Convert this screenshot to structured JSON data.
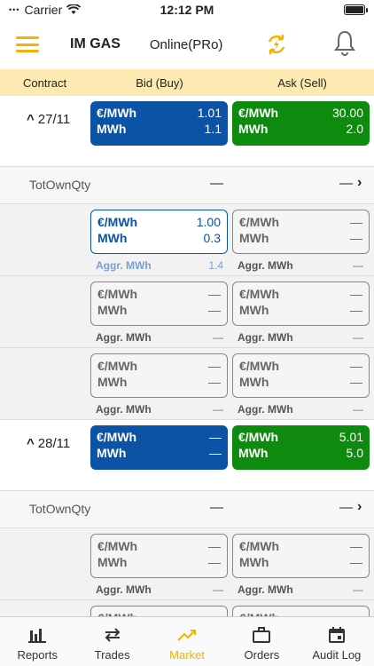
{
  "status_bar": {
    "carrier": "Carrier",
    "time": "12:12 PM"
  },
  "header": {
    "app_title": "IM GAS",
    "connection": "Online(PRo)"
  },
  "columns": {
    "contract": "Contract",
    "bid": "Bid (Buy)",
    "ask": "Ask (Sell)"
  },
  "units": {
    "price": "€/MWh",
    "qty": "MWh",
    "aggr": "Aggr. MWh"
  },
  "own_qty_label": "TotOwnQty",
  "dash": "—",
  "contracts": [
    {
      "label": "27/11",
      "bid": {
        "price": "1.01",
        "qty": "1.1"
      },
      "ask": {
        "price": "30.00",
        "qty": "2.0"
      },
      "own": {
        "bid": "—",
        "ask": "—"
      },
      "depth": [
        {
          "bid": {
            "price": "1.00",
            "qty": "0.3",
            "aggr": "1.4"
          },
          "ask": {
            "price": "—",
            "qty": "—",
            "aggr": "—"
          }
        },
        {
          "bid": {
            "price": "—",
            "qty": "—",
            "aggr": "—"
          },
          "ask": {
            "price": "—",
            "qty": "—",
            "aggr": "—"
          }
        },
        {
          "bid": {
            "price": "—",
            "qty": "—",
            "aggr": "—"
          },
          "ask": {
            "price": "—",
            "qty": "—",
            "aggr": "—"
          }
        }
      ]
    },
    {
      "label": "28/11",
      "bid": {
        "price": "—",
        "qty": "—"
      },
      "ask": {
        "price": "5.01",
        "qty": "5.0"
      },
      "own": {
        "bid": "—",
        "ask": "—"
      },
      "depth": [
        {
          "bid": {
            "price": "—",
            "qty": "—",
            "aggr": "—"
          },
          "ask": {
            "price": "—",
            "qty": "—",
            "aggr": "—"
          }
        },
        {
          "bid": {
            "price": "—",
            "qty": "—",
            "aggr": "—"
          },
          "ask": {
            "price": "—",
            "qty": "—",
            "aggr": "—"
          }
        }
      ]
    }
  ],
  "tabs": [
    {
      "label": "Reports",
      "icon": "bar-chart-icon"
    },
    {
      "label": "Trades",
      "icon": "swap-arrows-icon"
    },
    {
      "label": "Market",
      "icon": "trend-line-icon"
    },
    {
      "label": "Orders",
      "icon": "briefcase-icon"
    },
    {
      "label": "Audit Log",
      "icon": "calendar-icon"
    }
  ],
  "colors": {
    "accent": "#f0b400",
    "bid": "#0c52a5",
    "ask": "#0e8a0e",
    "header_band": "#fdeab3"
  }
}
